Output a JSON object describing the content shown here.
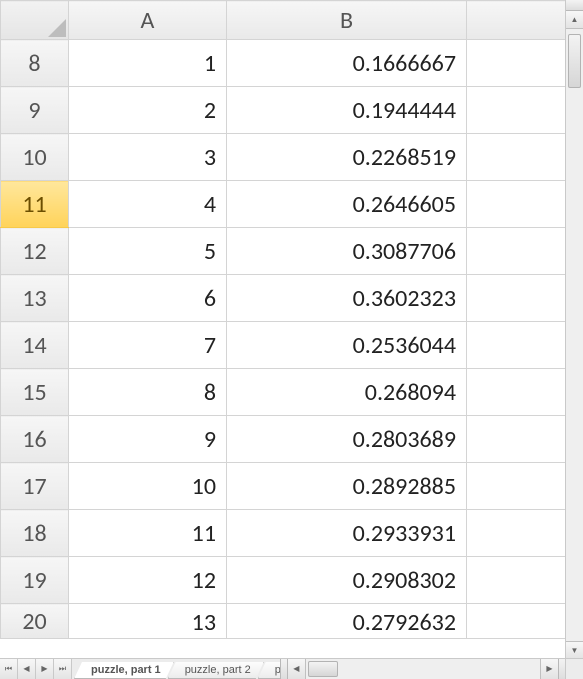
{
  "columns": [
    "A",
    "B"
  ],
  "selected_row_header": "11",
  "rows": [
    {
      "hdr": "8",
      "A": "1",
      "B": "0.1666667"
    },
    {
      "hdr": "9",
      "A": "2",
      "B": "0.1944444"
    },
    {
      "hdr": "10",
      "A": "3",
      "B": "0.2268519"
    },
    {
      "hdr": "11",
      "A": "4",
      "B": "0.2646605"
    },
    {
      "hdr": "12",
      "A": "5",
      "B": "0.3087706"
    },
    {
      "hdr": "13",
      "A": "6",
      "B": "0.3602323"
    },
    {
      "hdr": "14",
      "A": "7",
      "B": "0.2536044"
    },
    {
      "hdr": "15",
      "A": "8",
      "B": "0.268094"
    },
    {
      "hdr": "16",
      "A": "9",
      "B": "0.2803689"
    },
    {
      "hdr": "17",
      "A": "10",
      "B": "0.2892885"
    },
    {
      "hdr": "18",
      "A": "11",
      "B": "0.2933931"
    },
    {
      "hdr": "19",
      "A": "12",
      "B": "0.2908302"
    },
    {
      "hdr": "20",
      "A": "13",
      "B": "0.2792632"
    }
  ],
  "tabs": {
    "active": "puzzle, part 1",
    "items": [
      "puzzle, part 1",
      "puzzle, part 2"
    ],
    "partial": "p"
  }
}
